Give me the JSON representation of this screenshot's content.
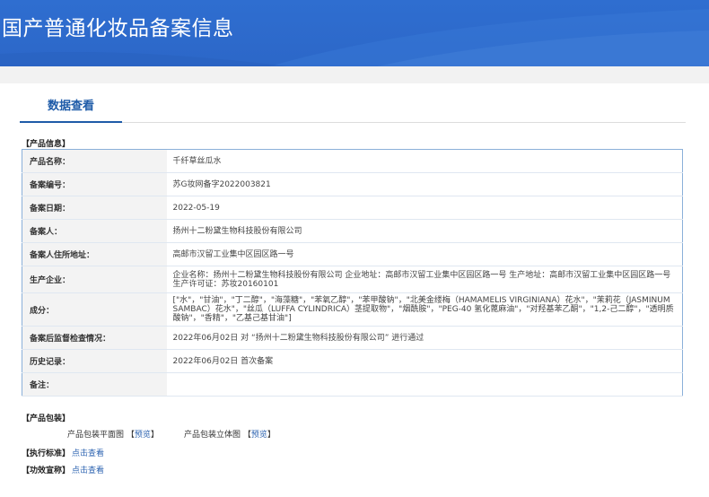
{
  "banner": {
    "title": "国产普通化妆品备案信息"
  },
  "tabs": [
    {
      "label": "数据查看"
    }
  ],
  "product_section": {
    "heading": "【产品信息】"
  },
  "rows": [
    {
      "label": "产品名称：",
      "value": "千纤草丝瓜水"
    },
    {
      "label": "备案编号：",
      "value": "苏G妆网备字2022003821"
    },
    {
      "label": "备案日期：",
      "value": "2022-05-19"
    },
    {
      "label": "备案人：",
      "value": "扬州十二粉黛生物科技股份有限公司"
    },
    {
      "label": "备案人住所地址：",
      "value": "高邮市汉留工业集中区园区路一号"
    },
    {
      "label": "生产企业：",
      "value": "企业名称：扬州十二粉黛生物科技股份有限公司 企业地址：高邮市汉留工业集中区园区路一号 生产地址：高邮市汉留工业集中区园区路一号 生产许可证：苏妆20160101"
    },
    {
      "label": "成分：",
      "value": "[\"水\"，\"甘油\"，\"丁二醇\"，\"海藻糖\"，\"苯氧乙醇\"，\"苯甲酸钠\"，\"北美金缕梅（HAMAMELIS VIRGINIANA）花水\"，\"茉莉花（JASMINUM SAMBAC）花水\"，\"丝瓜（LUFFA CYLINDRICA）茎提取物\"，\"烟酰胺\"，\"PEG-40 氢化蓖麻油\"，\"对羟基苯乙酮\"，\"1,2-己二醇\"，\"透明质酸钠\"，\"香精\"，\"乙基己基甘油\"]"
    },
    {
      "label": "备案后监督检查情况：",
      "value": "2022年06月02日 对 “扬州十二粉黛生物科技股份有限公司” 进行通过"
    },
    {
      "label": "历史记录：",
      "value": "2022年06月02日 首次备案"
    },
    {
      "label": "备注：",
      "value": ""
    }
  ],
  "package_section": {
    "heading": "【产品包装】",
    "flat_label": "产品包装平面图",
    "flat_link": "预览",
    "solid_label": "产品包装立体图",
    "solid_link": "预览",
    "bracket_open": "【",
    "bracket_close": "】"
  },
  "standard_section": {
    "heading": "【执行标准】",
    "link": "点击查看"
  },
  "efficacy_section": {
    "heading": "【功效宣称】",
    "link": "点击查看"
  },
  "colors": {
    "banner": "#2c67c8",
    "accent": "#1e5ba8",
    "link": "#2c63b0",
    "table_border": "#8bb0d9"
  }
}
